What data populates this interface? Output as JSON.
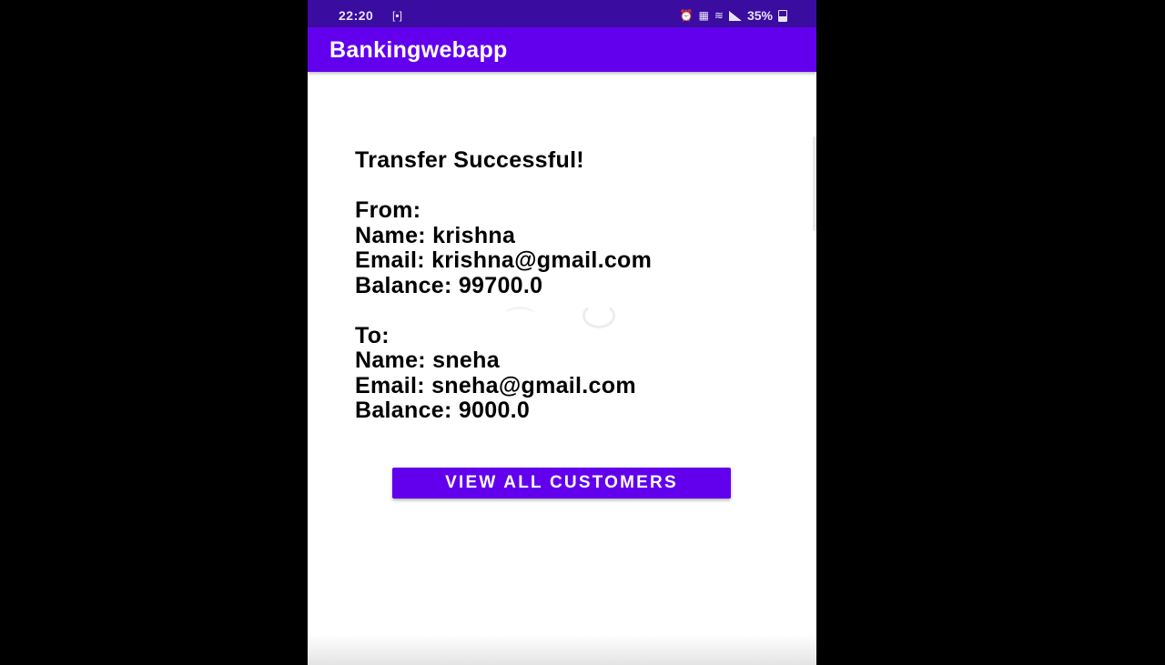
{
  "status_bar": {
    "time": "22:20",
    "battery": "35%"
  },
  "app_bar": {
    "title": "Bankingwebapp"
  },
  "transfer": {
    "heading": "Transfer Successful!",
    "from": {
      "label": "From:",
      "name": "Name: krishna",
      "email": "Email: krishna@gmail.com",
      "balance": "Balance: 99700.0"
    },
    "to": {
      "label": "To:",
      "name": "Name: sneha",
      "email": "Email: sneha@gmail.com",
      "balance": "Balance: 9000.0"
    }
  },
  "actions": {
    "view_all_label": "VIEW ALL CUSTOMERS"
  },
  "colors": {
    "status_bar": "#3a0ca0",
    "primary": "#6200ee",
    "background": "#ffffff",
    "text": "#000000"
  },
  "icons": {
    "status_screen": "screen-record-icon",
    "status_alarm": "alarm-icon",
    "status_signal": "signal-icon",
    "status_battery": "battery-icon"
  }
}
